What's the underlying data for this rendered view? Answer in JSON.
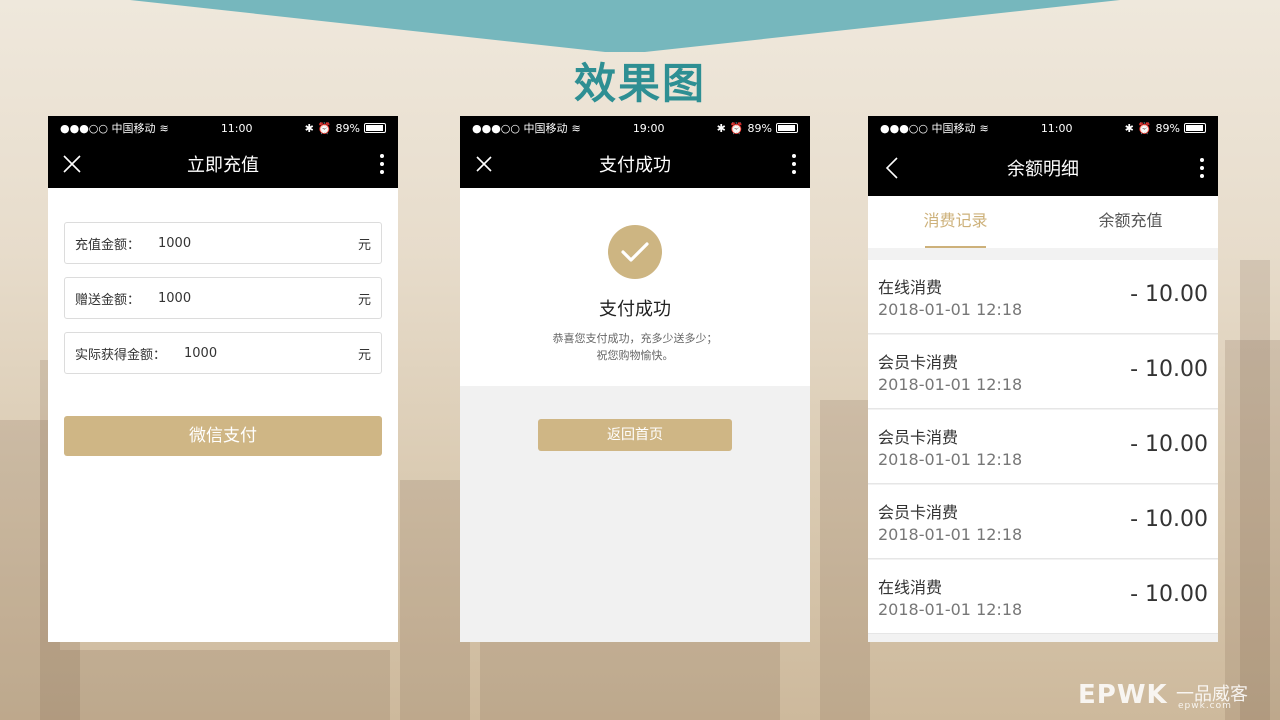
{
  "slide": {
    "title": "效果图"
  },
  "phone1": {
    "status": {
      "carrier": "●●●○○ 中国移动",
      "time": "11:00",
      "battery": "89%"
    },
    "nav_title": "立即充值",
    "fields": [
      {
        "label": "充值金额：",
        "value": "1000",
        "unit": "元"
      },
      {
        "label": "赠送金额：",
        "value": "1000",
        "unit": "元"
      },
      {
        "label": "实际获得金额：",
        "value": "1000",
        "unit": "元"
      }
    ],
    "pay_button": "微信支付"
  },
  "phone2": {
    "status": {
      "carrier": "●●●○○ 中国移动",
      "time": "19:00",
      "battery": "89%"
    },
    "nav_title": "支付成功",
    "success_title": "支付成功",
    "message_line1": "恭喜您支付成功，充多少送多少；",
    "message_line2": "祝您购物愉快。",
    "home_button": "返回首页"
  },
  "phone3": {
    "status": {
      "carrier": "●●●○○ 中国移动",
      "time": "11:00",
      "battery": "89%"
    },
    "nav_title": "余额明细",
    "tabs": [
      {
        "label": "消费记录"
      },
      {
        "label": "余额充值"
      }
    ],
    "records": [
      {
        "name": "在线消费",
        "time": "2018-01-01 12:18",
        "amount": "- 10.00"
      },
      {
        "name": "会员卡消费",
        "time": "2018-01-01 12:18",
        "amount": "- 10.00"
      },
      {
        "name": "会员卡消费",
        "time": "2018-01-01 12:18",
        "amount": "- 10.00"
      },
      {
        "name": "会员卡消费",
        "time": "2018-01-01 12:18",
        "amount": "- 10.00"
      },
      {
        "name": "在线消费",
        "time": "2018-01-01 12:18",
        "amount": "- 10.00"
      }
    ]
  },
  "watermark": {
    "brand": "EPWK",
    "cn": "一品威客",
    "url": "epwk.com"
  },
  "colors": {
    "accent_gold": "#cfb685",
    "title_teal": "#2e8f93",
    "banner": "#76b7bd"
  }
}
